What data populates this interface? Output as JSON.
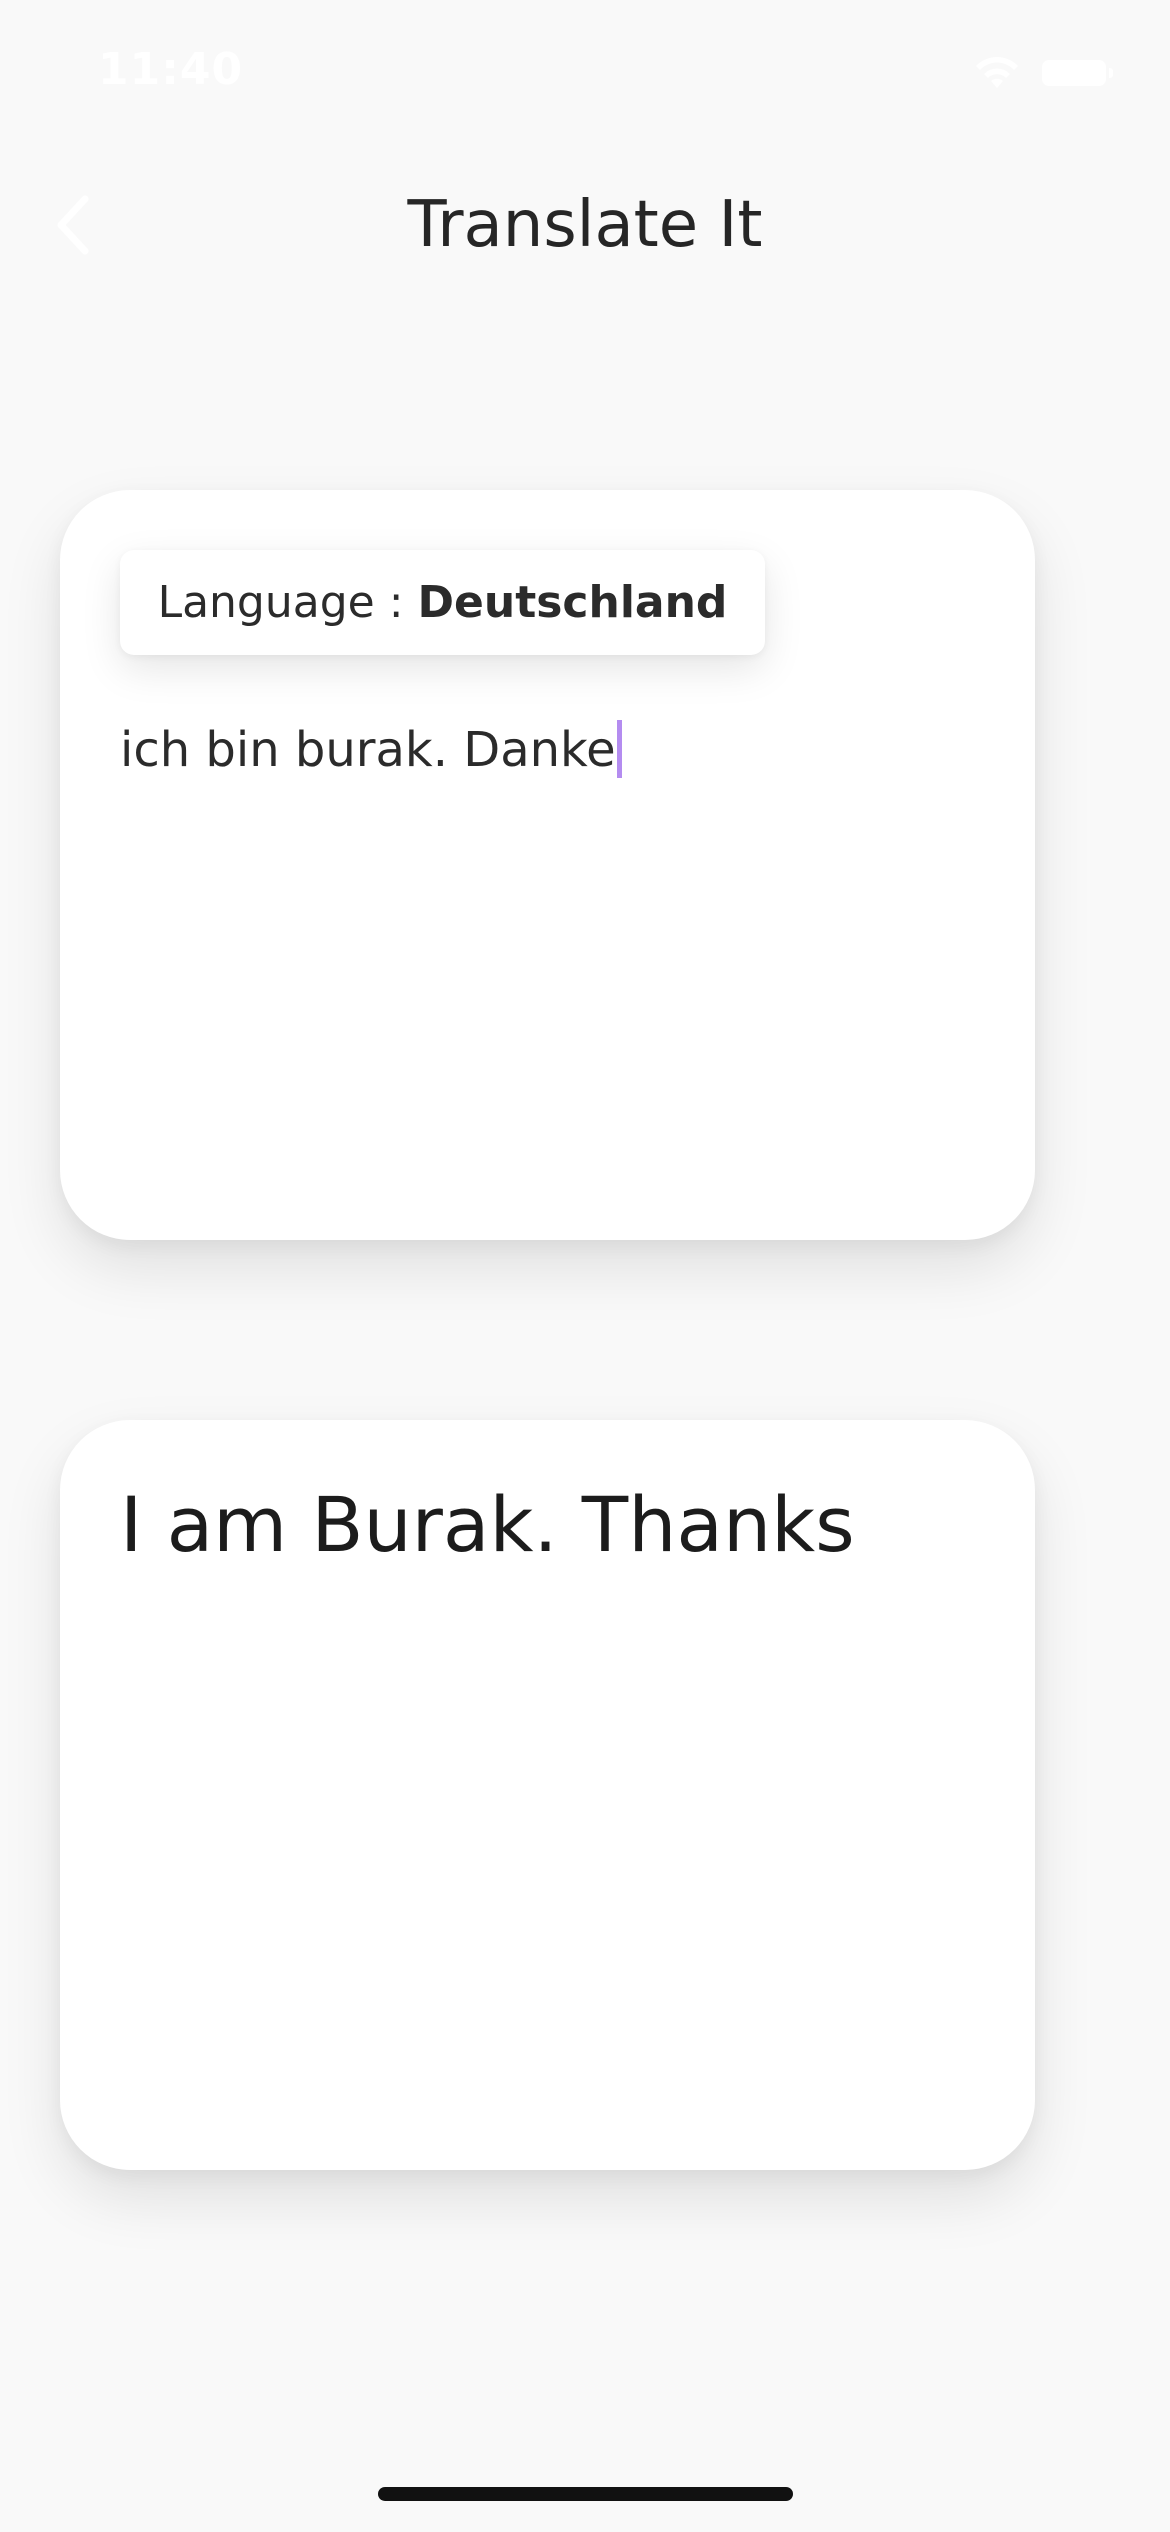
{
  "status_bar": {
    "time": "11:40",
    "wifi_icon": "wifi-icon",
    "battery_icon": "battery-icon",
    "foreground_color": "#ffffff"
  },
  "nav": {
    "back_icon": "chevron-left-icon",
    "title": "Translate It"
  },
  "input_card": {
    "language_label": "Language : ",
    "language_value": "Deutschland",
    "text_value": "ich bin burak. Danke",
    "cursor_color": "#b48cf0"
  },
  "output_card": {
    "translated_text": "I am Burak. Thanks"
  },
  "colors": {
    "background": "#f9f9f9",
    "card": "#ffffff",
    "text": "#222222"
  }
}
